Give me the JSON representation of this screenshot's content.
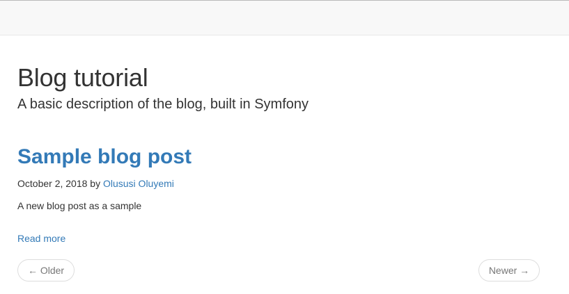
{
  "navbar": {},
  "blog": {
    "title": "Blog tutorial",
    "description": "A basic description of the blog, built in Symfony"
  },
  "post": {
    "title": "Sample blog post",
    "date": "October 2, 2018",
    "by_label": "by",
    "author": "Olususi Oluyemi",
    "excerpt": "A new blog post as a sample",
    "read_more": "Read more"
  },
  "pager": {
    "older": "← Older",
    "newer": "Newer →"
  }
}
